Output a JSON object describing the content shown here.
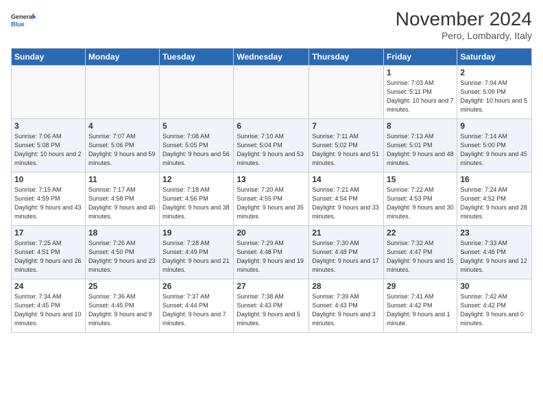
{
  "logo": {
    "line1": "General",
    "line2": "Blue"
  },
  "title": "November 2024",
  "subtitle": "Pero, Lombardy, Italy",
  "weekdays": [
    "Sunday",
    "Monday",
    "Tuesday",
    "Wednesday",
    "Thursday",
    "Friday",
    "Saturday"
  ],
  "weeks": [
    [
      {
        "day": "",
        "info": ""
      },
      {
        "day": "",
        "info": ""
      },
      {
        "day": "",
        "info": ""
      },
      {
        "day": "",
        "info": ""
      },
      {
        "day": "",
        "info": ""
      },
      {
        "day": "1",
        "info": "Sunrise: 7:03 AM\nSunset: 5:11 PM\nDaylight: 10 hours and 7 minutes."
      },
      {
        "day": "2",
        "info": "Sunrise: 7:04 AM\nSunset: 5:09 PM\nDaylight: 10 hours and 5 minutes."
      }
    ],
    [
      {
        "day": "3",
        "info": "Sunrise: 7:06 AM\nSunset: 5:08 PM\nDaylight: 10 hours and 2 minutes."
      },
      {
        "day": "4",
        "info": "Sunrise: 7:07 AM\nSunset: 5:06 PM\nDaylight: 9 hours and 59 minutes."
      },
      {
        "day": "5",
        "info": "Sunrise: 7:08 AM\nSunset: 5:05 PM\nDaylight: 9 hours and 56 minutes."
      },
      {
        "day": "6",
        "info": "Sunrise: 7:10 AM\nSunset: 5:04 PM\nDaylight: 9 hours and 53 minutes."
      },
      {
        "day": "7",
        "info": "Sunrise: 7:11 AM\nSunset: 5:02 PM\nDaylight: 9 hours and 51 minutes."
      },
      {
        "day": "8",
        "info": "Sunrise: 7:13 AM\nSunset: 5:01 PM\nDaylight: 9 hours and 48 minutes."
      },
      {
        "day": "9",
        "info": "Sunrise: 7:14 AM\nSunset: 5:00 PM\nDaylight: 9 hours and 45 minutes."
      }
    ],
    [
      {
        "day": "10",
        "info": "Sunrise: 7:15 AM\nSunset: 4:59 PM\nDaylight: 9 hours and 43 minutes."
      },
      {
        "day": "11",
        "info": "Sunrise: 7:17 AM\nSunset: 4:58 PM\nDaylight: 9 hours and 40 minutes."
      },
      {
        "day": "12",
        "info": "Sunrise: 7:18 AM\nSunset: 4:56 PM\nDaylight: 9 hours and 38 minutes."
      },
      {
        "day": "13",
        "info": "Sunrise: 7:20 AM\nSunset: 4:55 PM\nDaylight: 9 hours and 35 minutes."
      },
      {
        "day": "14",
        "info": "Sunrise: 7:21 AM\nSunset: 4:54 PM\nDaylight: 9 hours and 33 minutes."
      },
      {
        "day": "15",
        "info": "Sunrise: 7:22 AM\nSunset: 4:53 PM\nDaylight: 9 hours and 30 minutes."
      },
      {
        "day": "16",
        "info": "Sunrise: 7:24 AM\nSunset: 4:52 PM\nDaylight: 9 hours and 28 minutes."
      }
    ],
    [
      {
        "day": "17",
        "info": "Sunrise: 7:25 AM\nSunset: 4:51 PM\nDaylight: 9 hours and 26 minutes."
      },
      {
        "day": "18",
        "info": "Sunrise: 7:26 AM\nSunset: 4:50 PM\nDaylight: 9 hours and 23 minutes."
      },
      {
        "day": "19",
        "info": "Sunrise: 7:28 AM\nSunset: 4:49 PM\nDaylight: 9 hours and 21 minutes."
      },
      {
        "day": "20",
        "info": "Sunrise: 7:29 AM\nSunset: 4:48 PM\nDaylight: 9 hours and 19 minutes."
      },
      {
        "day": "21",
        "info": "Sunrise: 7:30 AM\nSunset: 4:48 PM\nDaylight: 9 hours and 17 minutes."
      },
      {
        "day": "22",
        "info": "Sunrise: 7:32 AM\nSunset: 4:47 PM\nDaylight: 9 hours and 15 minutes."
      },
      {
        "day": "23",
        "info": "Sunrise: 7:33 AM\nSunset: 4:46 PM\nDaylight: 9 hours and 12 minutes."
      }
    ],
    [
      {
        "day": "24",
        "info": "Sunrise: 7:34 AM\nSunset: 4:45 PM\nDaylight: 9 hours and 10 minutes."
      },
      {
        "day": "25",
        "info": "Sunrise: 7:36 AM\nSunset: 4:45 PM\nDaylight: 9 hours and 9 minutes."
      },
      {
        "day": "26",
        "info": "Sunrise: 7:37 AM\nSunset: 4:44 PM\nDaylight: 9 hours and 7 minutes."
      },
      {
        "day": "27",
        "info": "Sunrise: 7:38 AM\nSunset: 4:43 PM\nDaylight: 9 hours and 5 minutes."
      },
      {
        "day": "28",
        "info": "Sunrise: 7:39 AM\nSunset: 4:43 PM\nDaylight: 9 hours and 3 minutes."
      },
      {
        "day": "29",
        "info": "Sunrise: 7:41 AM\nSunset: 4:42 PM\nDaylight: 9 hours and 1 minute."
      },
      {
        "day": "30",
        "info": "Sunrise: 7:42 AM\nSunset: 4:42 PM\nDaylight: 9 hours and 0 minutes."
      }
    ]
  ]
}
